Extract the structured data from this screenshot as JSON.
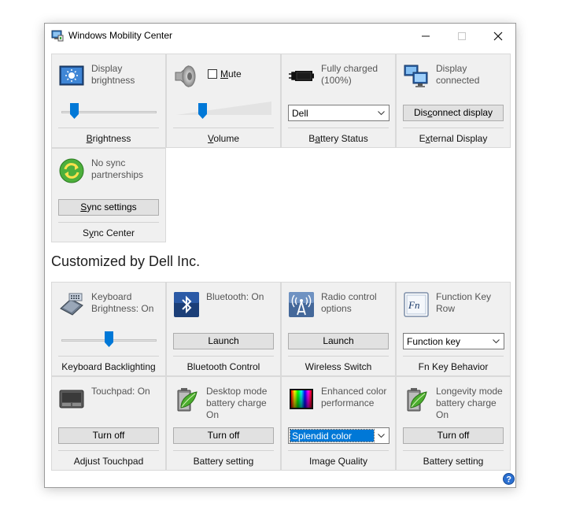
{
  "window": {
    "title": "Windows Mobility Center"
  },
  "tiles": [
    {
      "status": "Display brightness",
      "caption": "Brightness",
      "accel": "B",
      "control": "slider",
      "level": 0.15
    },
    {
      "status": "Mute",
      "caption": "Volume",
      "accel": "V",
      "control": "slider",
      "level": 0.25,
      "mute_checked": false
    },
    {
      "status": "Fully charged (100%)",
      "caption": "Battery Status",
      "accel": "a",
      "control": "select",
      "value": "Dell"
    },
    {
      "status": "Display connected",
      "caption": "External Display",
      "accel": "x",
      "control": "button",
      "button": "Disconnect display",
      "button_accel": "c"
    },
    {
      "status": "No sync partnerships",
      "caption": "Sync Center",
      "accel": "y",
      "control": "button",
      "button": "Sync settings",
      "button_accel": "S"
    }
  ],
  "section": {
    "heading": "Customized by Dell Inc."
  },
  "dell_tiles": [
    {
      "status": "Keyboard Brightness: On",
      "caption": "Keyboard Backlighting",
      "control": "slider",
      "level": 0.5
    },
    {
      "status": "Bluetooth: On",
      "caption": "Bluetooth Control",
      "control": "button",
      "button": "Launch"
    },
    {
      "status": "Radio control options",
      "caption": "Wireless Switch",
      "control": "button",
      "button": "Launch"
    },
    {
      "status": "Function Key Row",
      "caption": "Fn Key Behavior",
      "control": "select",
      "value": "Function key"
    },
    {
      "status": "Touchpad: On",
      "caption": "Adjust Touchpad",
      "control": "button",
      "button": "Turn off"
    },
    {
      "status": "Desktop mode battery charge On",
      "caption": "Battery setting",
      "control": "button",
      "button": "Turn off"
    },
    {
      "status": "Enhanced color performance",
      "caption": "Image Quality",
      "control": "select",
      "value": "Splendid color"
    },
    {
      "status": "Longevity mode battery charge On",
      "caption": "Battery setting",
      "control": "button",
      "button": "Turn off"
    }
  ],
  "icons": {
    "app": "mobility-center-icon",
    "display": "display-brightness-icon",
    "volume": "speaker-icon",
    "battery": "battery-plug-icon",
    "external": "external-display-icon",
    "sync": "sync-center-icon",
    "keyboard": "keyboard-backlight-icon",
    "bluetooth": "bluetooth-icon",
    "wireless": "wireless-antenna-icon",
    "fn": "fn-key-icon",
    "touchpad": "touchpad-icon",
    "battery_leaf": "battery-leaf-icon",
    "color": "color-spectrum-icon",
    "help": "help-icon"
  },
  "colors": {
    "accent": "#0078d7",
    "tile_bg": "#f0f0f0"
  }
}
